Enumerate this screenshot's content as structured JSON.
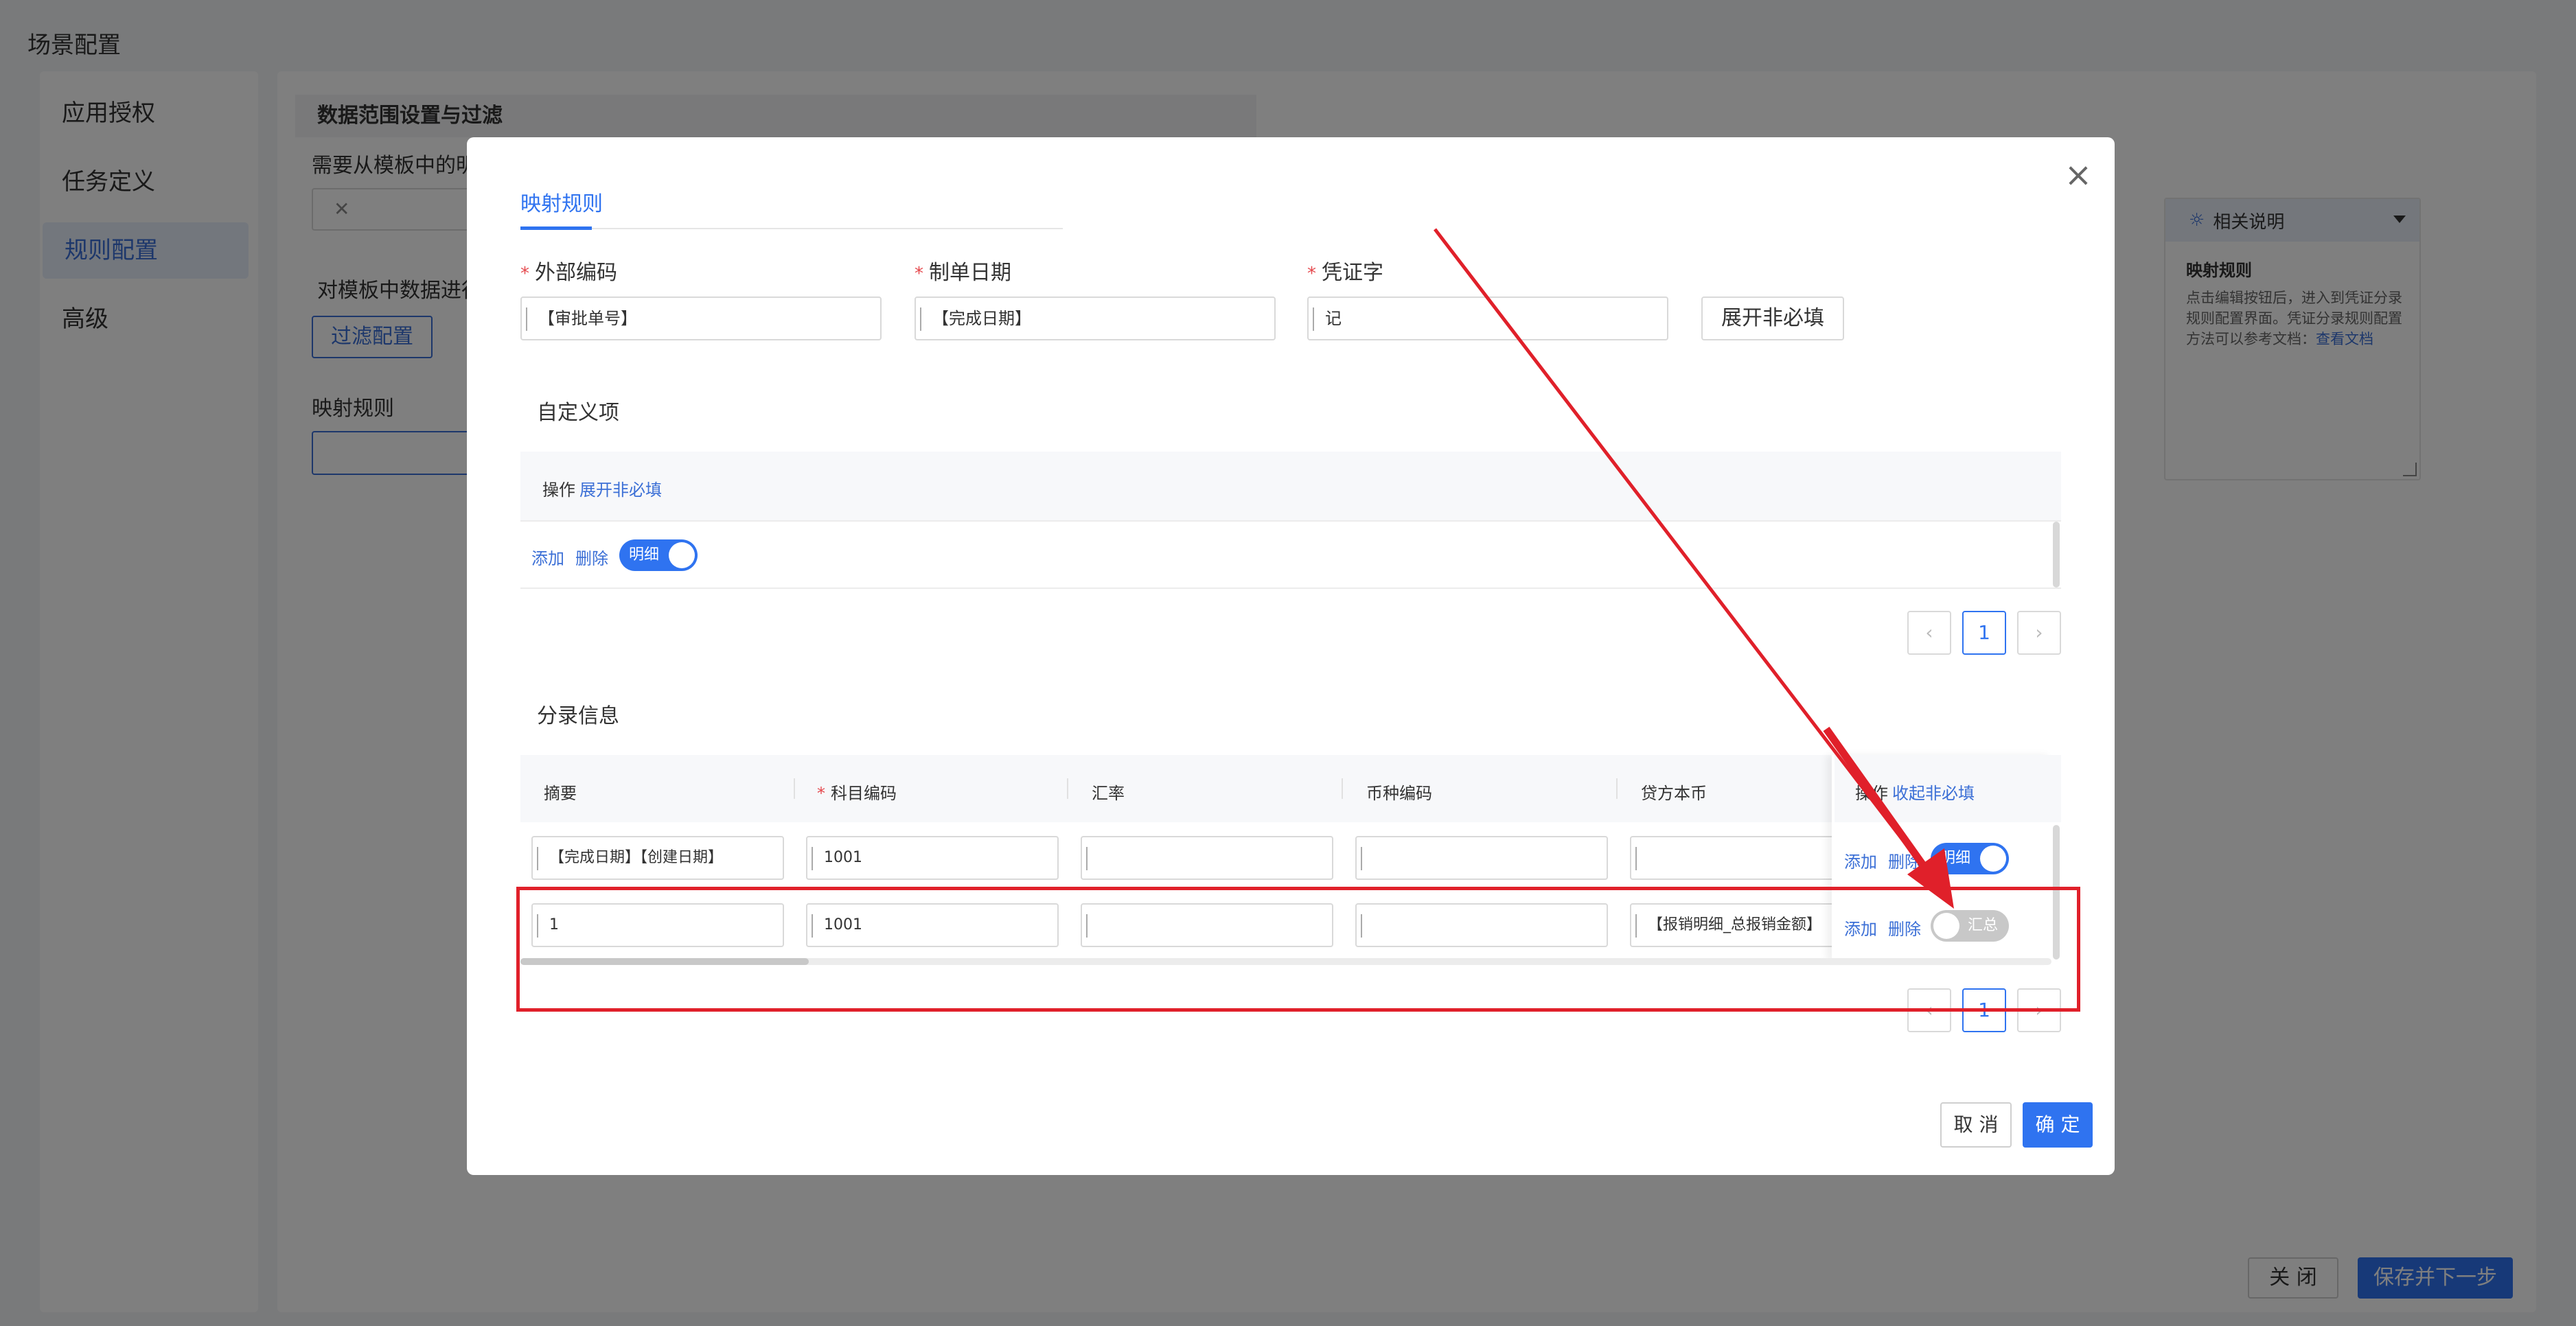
{
  "page": {
    "title": "场景配置",
    "menu": [
      {
        "label": "应用授权",
        "active": false
      },
      {
        "label": "任务定义",
        "active": false
      },
      {
        "label": "规则配置",
        "active": true
      },
      {
        "label": "高级",
        "active": false
      }
    ],
    "section_title": "数据范围设置与过滤",
    "text_need_template": "需要从模板中的明",
    "text_filter_template": "对模板中数据进行",
    "filter_button": "过滤配置",
    "mapping_rule_label": "映射规则",
    "help": {
      "header": "相关说明",
      "title": "映射规则",
      "body": "点击编辑按钮后，进入到凭证分录规则配置界面。凭证分录规则配置方法可以参考文档：",
      "link": "查看文档"
    },
    "close_button": "关 闭",
    "next_button": "保存并下一步"
  },
  "modal": {
    "tab": "映射规则",
    "fields": {
      "external_code": {
        "label": "外部编码",
        "value": "【审批单号】"
      },
      "bill_date": {
        "label": "制单日期",
        "value": "【完成日期】"
      },
      "voucher_word": {
        "label": "凭证字",
        "value": "记"
      }
    },
    "expand_button": "展开非必填",
    "custom_section": {
      "title": "自定义项",
      "header_op": "操作",
      "header_link": "展开非必填",
      "row": {
        "add": "添加",
        "delete": "删除",
        "toggle": "明细"
      },
      "page": "1"
    },
    "entry_section": {
      "title": "分录信息",
      "columns": [
        "摘要",
        "科目编码",
        "汇率",
        "币种编码",
        "贷方本币"
      ],
      "op_header": "操作",
      "op_link": "收起非必填",
      "rows": [
        {
          "summary": "【完成日期】【创建日期】",
          "subject": "1001",
          "rate": "",
          "currency": "",
          "credit": "",
          "add": "添加",
          "delete": "删除",
          "toggle": "明细",
          "toggle_on": true
        },
        {
          "summary": "1",
          "subject": "1001",
          "rate": "",
          "currency": "",
          "credit": "【报销明细_总报销金额】",
          "add": "添加",
          "delete": "删除",
          "toggle": "汇总",
          "toggle_on": false
        }
      ],
      "page": "1"
    },
    "cancel_button": "取 消",
    "ok_button": "确 定"
  },
  "colors": {
    "primary": "#2f73f0",
    "required": "#e5484d",
    "annotation": "#e0202a"
  },
  "icons": [
    "close-icon",
    "lightbulb-icon",
    "chevron-down-icon",
    "chevron-left-icon",
    "chevron-right-icon"
  ]
}
